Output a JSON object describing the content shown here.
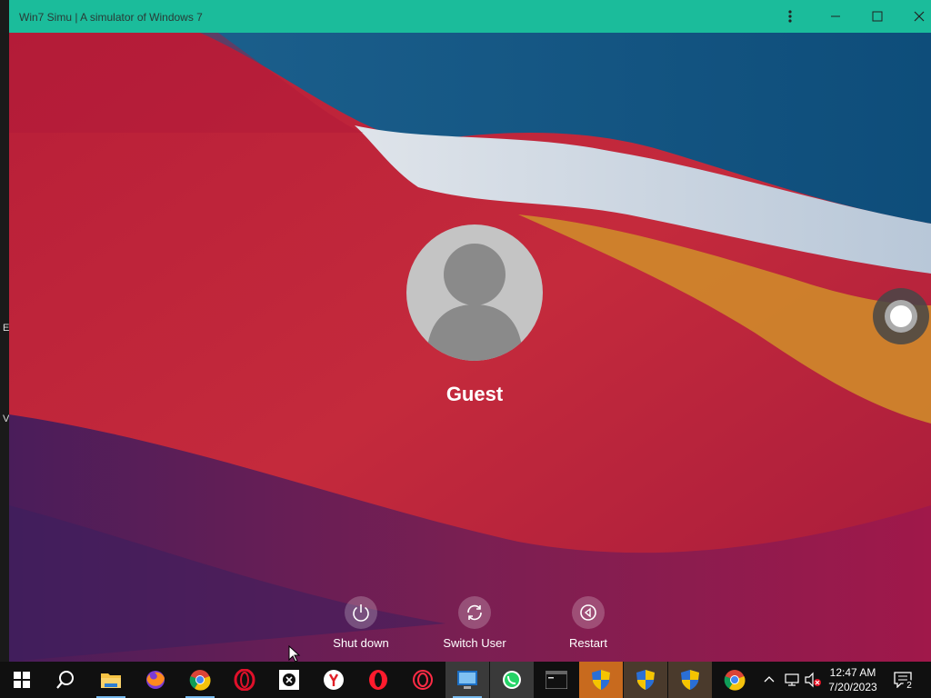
{
  "window": {
    "title": "Win7 Simu | A simulator of Windows 7",
    "buttons": [
      "more-options",
      "minimize",
      "maximize",
      "close"
    ]
  },
  "host_edge_letters": [
    "E",
    "V"
  ],
  "lock_screen": {
    "user_name": "Guest",
    "actions": [
      {
        "label": "Shut down",
        "icon": "power-icon"
      },
      {
        "label": "Switch User",
        "icon": "switch-user-icon"
      },
      {
        "label": "Restart",
        "icon": "restart-icon"
      }
    ]
  },
  "taskbar": {
    "apps": [
      "start",
      "search",
      "file-explorer",
      "firefox",
      "chrome",
      "opera",
      "app-x",
      "yandex",
      "opera-red",
      "opera-gx",
      "remote-desktop",
      "whatsapp",
      "terminal",
      "shield-1",
      "shield-2",
      "shield-3",
      "chrome-2"
    ],
    "clock_time": "12:47 AM",
    "clock_date": "7/20/2023",
    "notification_count": "2"
  }
}
